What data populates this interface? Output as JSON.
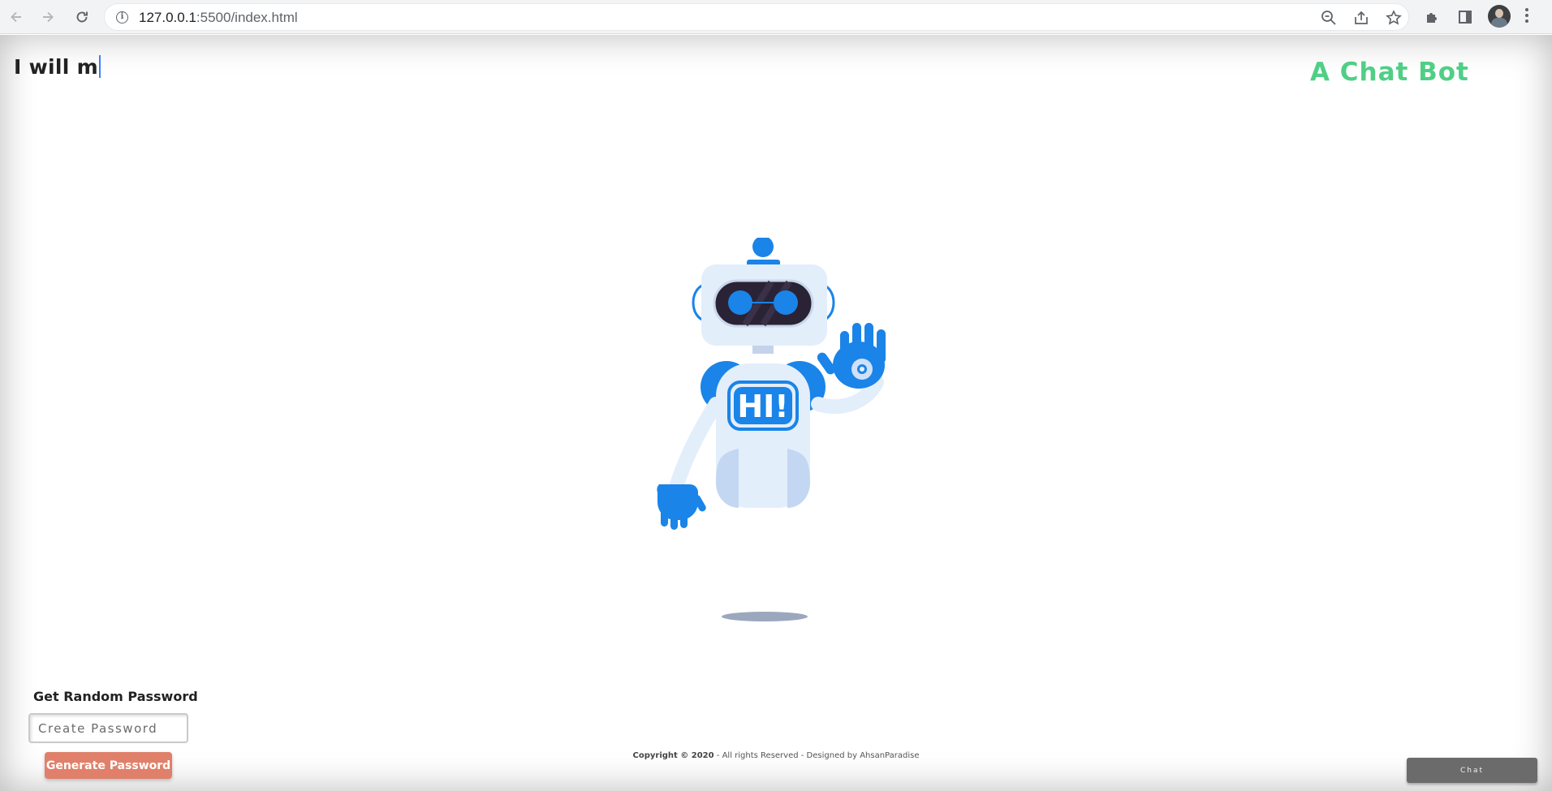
{
  "browser": {
    "url_host": "127.0.0.1",
    "url_rest": ":5500/index.html"
  },
  "page": {
    "typed_heading": "I will m",
    "brand_title": "A Chat Bot",
    "robot": {
      "badge_text": "HI!"
    },
    "password": {
      "title": "Get Random Password",
      "input_placeholder": "Create Password",
      "input_value": "",
      "button_label": "Generate Password"
    },
    "footer": {
      "copyright": "Copyright © 2020",
      "rest": " - All rights Reserved - Designed by AhsanParadise"
    },
    "chat_button_label": "Chat"
  },
  "colors": {
    "brand_green": "#4fcf86",
    "robot_blue": "#1a84e8",
    "robot_light": "#e6f0fb",
    "generate_button": "#e0806a",
    "chat_button": "#6b6b6b"
  }
}
